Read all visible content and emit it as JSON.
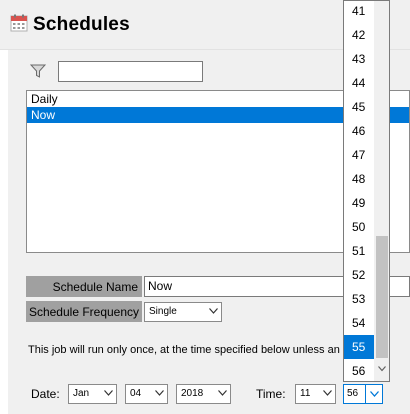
{
  "header": {
    "title": "Schedules",
    "icon": "calendar-icon"
  },
  "filter": {
    "icon": "filter-icon",
    "value": ""
  },
  "schedule_list": {
    "items": [
      "Daily",
      "Now"
    ],
    "selected": "Now"
  },
  "form": {
    "schedule_name_label": "Schedule Name",
    "schedule_name_value": "Now",
    "schedule_frequency_label": "Schedule Frequency",
    "schedule_frequency_value": "Single"
  },
  "description": "This job will run only once, at the time specified below unless an error",
  "date": {
    "label": "Date:",
    "month": "Jan",
    "day": "04",
    "year": "2018"
  },
  "time": {
    "label": "Time:",
    "hour": "11",
    "minute": "56"
  },
  "minute_dropdown": {
    "options": [
      "41",
      "42",
      "43",
      "44",
      "45",
      "46",
      "47",
      "48",
      "49",
      "50",
      "51",
      "52",
      "53",
      "54",
      "55",
      "56"
    ],
    "highlighted": "55"
  },
  "colors": {
    "selection": "#0078d7",
    "panel": "#f0f0f0",
    "label_bg": "#a0a0a0"
  }
}
